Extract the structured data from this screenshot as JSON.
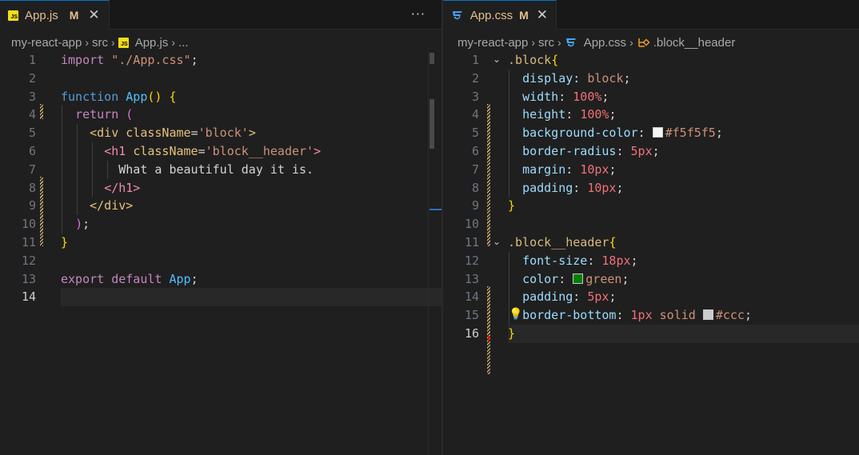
{
  "left": {
    "tab": {
      "icon": "js-icon",
      "label": "App.js",
      "modified": "M",
      "close": "✕"
    },
    "more": "···",
    "breadcrumb": {
      "project": "my-react-app",
      "folder": "src",
      "file": "App.js",
      "tail": "..."
    },
    "current_line": 14,
    "lines": [
      {
        "n": 1,
        "tokens": [
          [
            "kw",
            "import "
          ],
          [
            "str",
            "\"./App.css\""
          ],
          [
            "white",
            ";"
          ]
        ]
      },
      {
        "n": 2,
        "tokens": []
      },
      {
        "n": 3,
        "tokens": [
          [
            "kw2",
            "function "
          ],
          [
            "fnb",
            "App"
          ],
          [
            "paren1",
            "() {"
          ]
        ]
      },
      {
        "n": 4,
        "tokens": [
          [
            "white",
            "  "
          ],
          [
            "kw",
            "return "
          ],
          [
            "paren2",
            "("
          ]
        ]
      },
      {
        "n": 5,
        "tokens": [
          [
            "white",
            "    "
          ],
          [
            "tagg",
            "<div "
          ],
          [
            "attr",
            "className"
          ],
          [
            "white",
            "="
          ],
          [
            "strg",
            "'block'"
          ],
          [
            "tagg",
            ">"
          ]
        ]
      },
      {
        "n": 6,
        "tokens": [
          [
            "white",
            "      "
          ],
          [
            "tag",
            "<h1 "
          ],
          [
            "attr",
            "className"
          ],
          [
            "white",
            "="
          ],
          [
            "strg",
            "'block__header'"
          ],
          [
            "tag",
            ">"
          ]
        ]
      },
      {
        "n": 7,
        "tokens": [
          [
            "white",
            "        "
          ],
          [
            "txt",
            "What a beautiful day it is."
          ]
        ]
      },
      {
        "n": 8,
        "tokens": [
          [
            "white",
            "      "
          ],
          [
            "tag",
            "</h1>"
          ]
        ]
      },
      {
        "n": 9,
        "tokens": [
          [
            "white",
            "    "
          ],
          [
            "tagg",
            "</div>"
          ]
        ]
      },
      {
        "n": 10,
        "tokens": [
          [
            "white",
            "  "
          ],
          [
            "paren2",
            ")"
          ],
          [
            "white",
            ";"
          ]
        ]
      },
      {
        "n": 11,
        "tokens": [
          [
            "paren1",
            "}"
          ]
        ]
      },
      {
        "n": 12,
        "tokens": []
      },
      {
        "n": 13,
        "tokens": [
          [
            "kw",
            "export default "
          ],
          [
            "fnb",
            "App"
          ],
          [
            "white",
            ";"
          ]
        ]
      },
      {
        "n": 14,
        "tokens": []
      }
    ]
  },
  "right": {
    "tab": {
      "icon": "css-icon",
      "label": "App.css",
      "modified": "M",
      "close": "✕"
    },
    "breadcrumb": {
      "project": "my-react-app",
      "folder": "src",
      "file": "App.css",
      "symbol": ".block__header"
    },
    "current_line": 16,
    "lines": [
      {
        "n": 1,
        "tokens": [
          [
            "sel",
            ".block"
          ],
          [
            "paren1",
            "{"
          ]
        ]
      },
      {
        "n": 2,
        "tokens": [
          [
            "white",
            "  "
          ],
          [
            "prop",
            "display"
          ],
          [
            "white",
            ": "
          ],
          [
            "val",
            "block"
          ],
          [
            "white",
            ";"
          ]
        ]
      },
      {
        "n": 3,
        "tokens": [
          [
            "white",
            "  "
          ],
          [
            "prop",
            "width"
          ],
          [
            "white",
            ": "
          ],
          [
            "num",
            "100%"
          ],
          [
            "white",
            ";"
          ]
        ]
      },
      {
        "n": 4,
        "tokens": [
          [
            "white",
            "  "
          ],
          [
            "prop",
            "height"
          ],
          [
            "white",
            ": "
          ],
          [
            "num",
            "100%"
          ],
          [
            "white",
            ";"
          ]
        ]
      },
      {
        "n": 5,
        "tokens": [
          [
            "white",
            "  "
          ],
          [
            "prop",
            "background-color"
          ],
          [
            "white",
            ": "
          ],
          [
            "swatch",
            "#f5f5f5"
          ],
          [
            "val",
            "#f5f5f5"
          ],
          [
            "white",
            ";"
          ]
        ]
      },
      {
        "n": 6,
        "tokens": [
          [
            "white",
            "  "
          ],
          [
            "prop",
            "border-radius"
          ],
          [
            "white",
            ": "
          ],
          [
            "num",
            "5px"
          ],
          [
            "white",
            ";"
          ]
        ]
      },
      {
        "n": 7,
        "tokens": [
          [
            "white",
            "  "
          ],
          [
            "prop",
            "margin"
          ],
          [
            "white",
            ": "
          ],
          [
            "num",
            "10px"
          ],
          [
            "white",
            ";"
          ]
        ]
      },
      {
        "n": 8,
        "tokens": [
          [
            "white",
            "  "
          ],
          [
            "prop",
            "padding"
          ],
          [
            "white",
            ": "
          ],
          [
            "num",
            "10px"
          ],
          [
            "white",
            ";"
          ]
        ]
      },
      {
        "n": 9,
        "tokens": [
          [
            "paren1",
            "}"
          ]
        ]
      },
      {
        "n": 10,
        "tokens": []
      },
      {
        "n": 11,
        "tokens": [
          [
            "sel",
            ".block__header"
          ],
          [
            "paren1",
            "{"
          ]
        ]
      },
      {
        "n": 12,
        "tokens": [
          [
            "white",
            "  "
          ],
          [
            "prop",
            "font-size"
          ],
          [
            "white",
            ": "
          ],
          [
            "num",
            "18px"
          ],
          [
            "white",
            ";"
          ]
        ]
      },
      {
        "n": 13,
        "tokens": [
          [
            "white",
            "  "
          ],
          [
            "prop",
            "color"
          ],
          [
            "white",
            ": "
          ],
          [
            "swatch",
            "#008000"
          ],
          [
            "val",
            "green"
          ],
          [
            "white",
            ";"
          ]
        ]
      },
      {
        "n": 14,
        "tokens": [
          [
            "white",
            "  "
          ],
          [
            "prop",
            "padding"
          ],
          [
            "white",
            ": "
          ],
          [
            "num",
            "5px"
          ],
          [
            "white",
            ";"
          ]
        ]
      },
      {
        "n": 15,
        "tokens": [
          [
            "white",
            "  "
          ],
          [
            "prop",
            "border-bottom"
          ],
          [
            "white",
            ": "
          ],
          [
            "num",
            "1px"
          ],
          [
            "val",
            " solid "
          ],
          [
            "swatch",
            "#cccccc"
          ],
          [
            "val",
            "#ccc"
          ],
          [
            "white",
            ";"
          ]
        ]
      },
      {
        "n": 16,
        "tokens": [
          [
            "paren1",
            "}"
          ]
        ]
      }
    ]
  },
  "colors": {
    "accent": "#0078d4",
    "modified": "#e2c08d",
    "background": "#1f1f1f"
  }
}
